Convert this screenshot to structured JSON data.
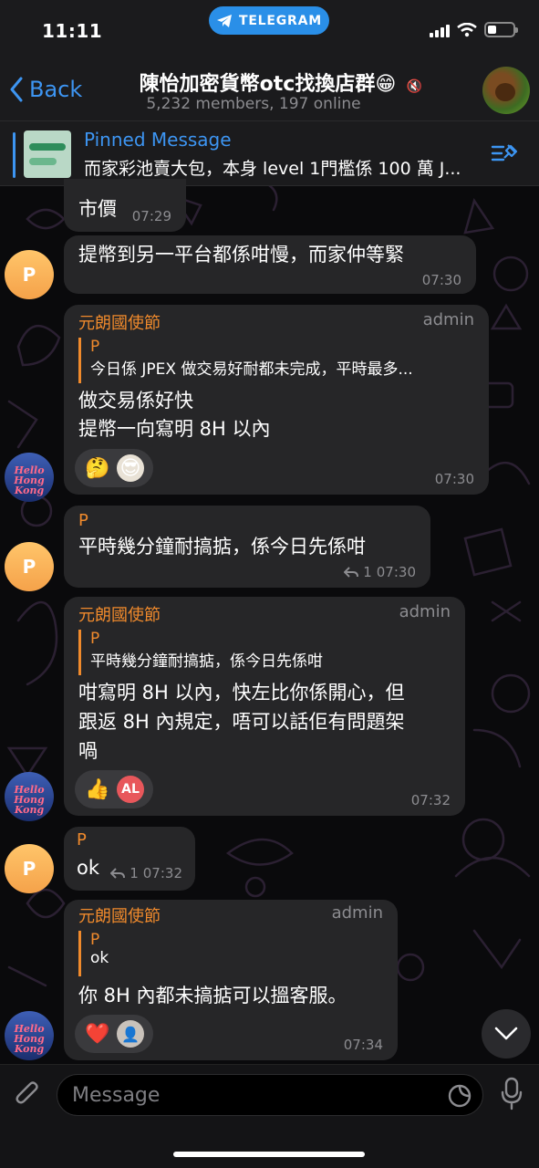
{
  "status_bar": {
    "time": "11:11",
    "pill": "TELEGRAM"
  },
  "header": {
    "back_label": "Back",
    "title": "陳怡加密貨幣otc找換店群😁",
    "subtitle": "5,232 members, 197 online"
  },
  "pinned": {
    "label": "Pinned Message",
    "text": "而家彩池賣大包，本身 level 1門檻係 100 萬 J..."
  },
  "messages": [
    {
      "text": "市價",
      "time": "07:29"
    },
    {
      "avatar": "P",
      "text": "提幣到另一平台都係咁慢，而家仲等緊",
      "time": "07:30"
    },
    {
      "sender": "元朗國使節",
      "role": "admin",
      "reply_name": "P",
      "reply_text": "今日係 JPEX 做交易好耐都未完成，平時最多...",
      "lines": [
        "做交易係好快",
        "提幣一向寫明 8H 以內"
      ],
      "reactions": [
        "🤔",
        "😎"
      ],
      "time": "07:30"
    },
    {
      "avatar": "P",
      "sender": "P",
      "text": "平時幾分鐘耐搞掂，係今日先係咁",
      "reply_count": "1",
      "time": "07:30"
    },
    {
      "sender": "元朗國使節",
      "role": "admin",
      "reply_name": "P",
      "reply_text": "平時幾分鐘耐搞掂，係今日先係咁",
      "lines": [
        "咁寫明 8H 以內，快左比你係開心，但",
        "跟返 8H 內規定，唔可以話佢有問題架",
        "喎"
      ],
      "reactions": [
        "👍",
        "AL"
      ],
      "time": "07:32"
    },
    {
      "avatar": "P",
      "sender": "P",
      "text": "ok",
      "reply_count": "1",
      "time": "07:32"
    },
    {
      "sender": "元朗國使節",
      "role": "admin",
      "reply_name": "P",
      "reply_text": "ok",
      "lines": [
        "你 8H 內都未搞掂可以搵客服。"
      ],
      "reactions": [
        "❤️",
        "👤"
      ],
      "time": "07:34"
    }
  ],
  "hk_avatar_text": "Hello Hong Kong",
  "composer": {
    "placeholder": "Message"
  },
  "colors": {
    "accent": "#3d95f2",
    "sender": "#f08a2c",
    "bubble": "#262628"
  }
}
